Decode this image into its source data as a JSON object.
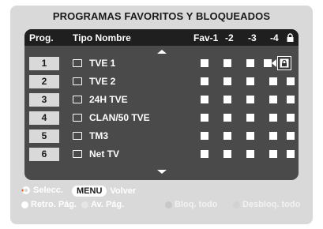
{
  "title": "PROGRAMAS FAVORITOS Y BLOQUEADOS",
  "header": {
    "prog": "Prog.",
    "tipo_nombre": "Tipo Nombre",
    "fav1": "Fav-1",
    "fav2": "-2",
    "fav3": "-3",
    "fav4": "-4",
    "lock_icon": "lock-icon"
  },
  "rows": [
    {
      "num": "1",
      "name": "TVE 1"
    },
    {
      "num": "2",
      "name": "TVE 2"
    },
    {
      "num": "3",
      "name": "24H TVE"
    },
    {
      "num": "4",
      "name": "CLAN/50 TVE"
    },
    {
      "num": "5",
      "name": "TM3"
    },
    {
      "num": "6",
      "name": "Net TV"
    }
  ],
  "footer": {
    "select": "Selecc.",
    "menu": "MENU",
    "back": "Volver",
    "prev_page": "Retro. Pág.",
    "next_page": "Av. Pág.",
    "lock_all": "Bloq. todo",
    "unlock_all": "Desbloq. todo"
  },
  "colors": {
    "frame": "#d9d9d9",
    "panel": "#4a4a4a",
    "header": "#1f1f1f",
    "white_dot": "#ffffff",
    "gray_dot": "#bdbdbd",
    "light_dot": "#cfcfcf"
  }
}
